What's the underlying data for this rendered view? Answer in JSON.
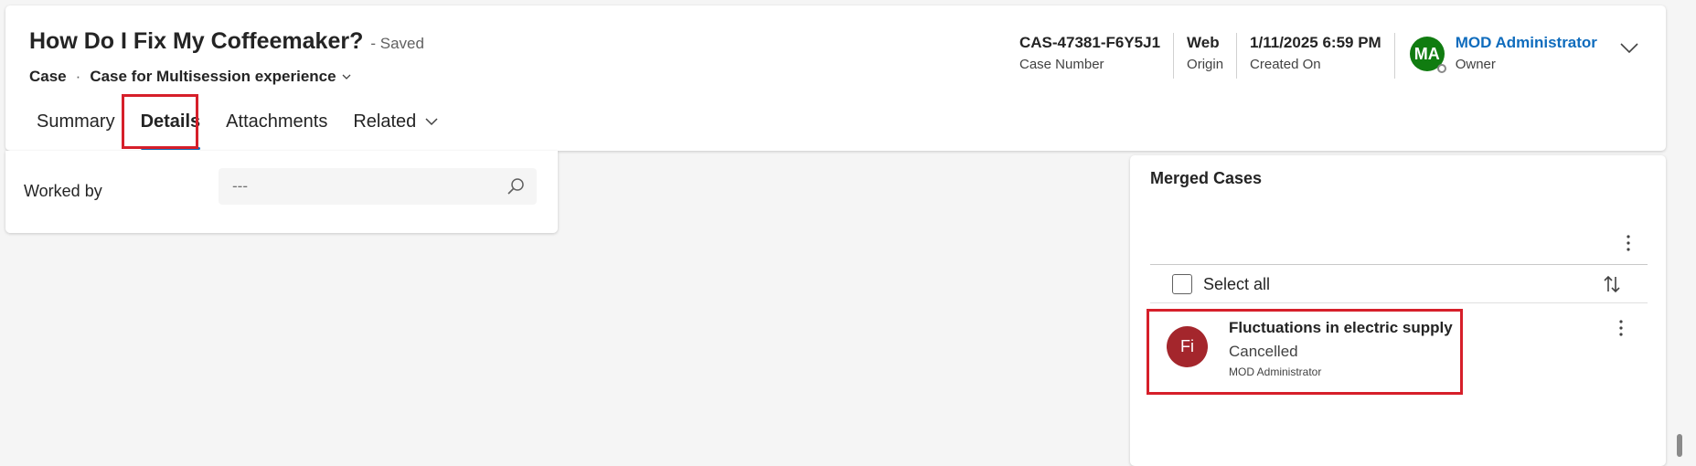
{
  "header": {
    "title": "How Do I Fix My Coffeemaker?",
    "save_status": "- Saved",
    "entity": "Case",
    "separator": "·",
    "form_name": "Case for Multisession experience",
    "tabs": [
      {
        "label": "Summary"
      },
      {
        "label": "Details"
      },
      {
        "label": "Attachments"
      },
      {
        "label": "Related"
      }
    ],
    "selected_tab": "Details",
    "fields": [
      {
        "value": "CAS-47381-F6Y5J1",
        "label": "Case Number"
      },
      {
        "value": "Web",
        "label": "Origin"
      },
      {
        "value": "1/11/2025 6:59 PM",
        "label": "Created On"
      }
    ],
    "owner": {
      "initials": "MA",
      "name": "MOD Administrator",
      "label": "Owner",
      "avatar_color": "#107c10"
    }
  },
  "worked_by": {
    "label": "Worked by",
    "value": "---",
    "icon": "search-icon"
  },
  "merged_cases": {
    "title": "Merged Cases",
    "select_all_label": "Select all",
    "records": [
      {
        "initials": "Fi",
        "title": "Fluctuations in electric supply",
        "status": "Cancelled",
        "owner": "MOD Administrator",
        "avatar_color": "#a4262c"
      }
    ]
  },
  "colors": {
    "accent": "#0f6cbd",
    "highlight": "#d61f2a"
  }
}
